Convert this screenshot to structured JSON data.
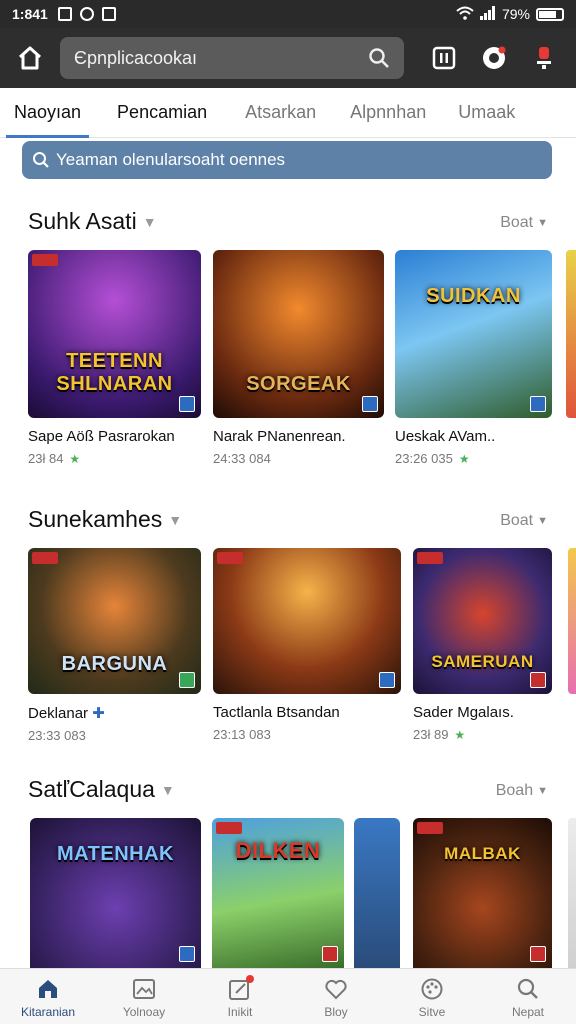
{
  "status": {
    "time": "1:841",
    "battery": "79%"
  },
  "toolbar": {
    "search_text": "Єpnplicacookaı"
  },
  "tabs": [
    {
      "label": "Naoyıan"
    },
    {
      "label": "Pencamian"
    },
    {
      "label": "Atsarkan"
    },
    {
      "label": "Alpnnhan"
    },
    {
      "label": "Umaak"
    }
  ],
  "filter": {
    "text": "Yeaman olenularsoaht oennes"
  },
  "sections": [
    {
      "title": "Suhk Asati",
      "more": "Boat",
      "cards": [
        {
          "art_title": "TEETENN SHLNARAN",
          "name": "Sape Aöß Pasrarokan",
          "meta": "23ł 84"
        },
        {
          "art_title": "SORGEAK",
          "name": "Narak PNanenrean.",
          "meta": "24:33 084"
        },
        {
          "art_title": "SUIDKAN",
          "name": "Ueskak AVam..",
          "meta": "23:26 035"
        }
      ]
    },
    {
      "title": "Sunekamhes",
      "more": "Boat",
      "cards": [
        {
          "art_title": "BARGUNA",
          "name": "Deklanar",
          "meta": "23:33 083"
        },
        {
          "art_title": "",
          "name": "Tactlanla Btsandan",
          "meta": "23:13 083"
        },
        {
          "art_title": "SAMERUAN",
          "name": "Sader Mgalaıs.",
          "meta": "23ł 89"
        }
      ]
    },
    {
      "title": "SatľCalaqua",
      "more": "Boah",
      "cards": [
        {
          "art_title": "MATENHAK",
          "name": "",
          "meta": ""
        },
        {
          "art_title": "DILKEN",
          "name": "",
          "meta": ""
        },
        {
          "art_title": "MALBAK",
          "name": "",
          "meta": ""
        }
      ]
    }
  ],
  "nav": [
    {
      "label": "Kitaranian",
      "icon": "home-icon"
    },
    {
      "label": "Yolnoay",
      "icon": "image-icon"
    },
    {
      "label": "Inikit",
      "icon": "edit-icon"
    },
    {
      "label": "Bloy",
      "icon": "heart-icon"
    },
    {
      "label": "Sitve",
      "icon": "palette-icon"
    },
    {
      "label": "Nepat",
      "icon": "search-icon"
    }
  ],
  "colors": {
    "accent": "#3f78c9",
    "filter_bg": "#5d81a7",
    "topbar": "#2e2e2e"
  }
}
